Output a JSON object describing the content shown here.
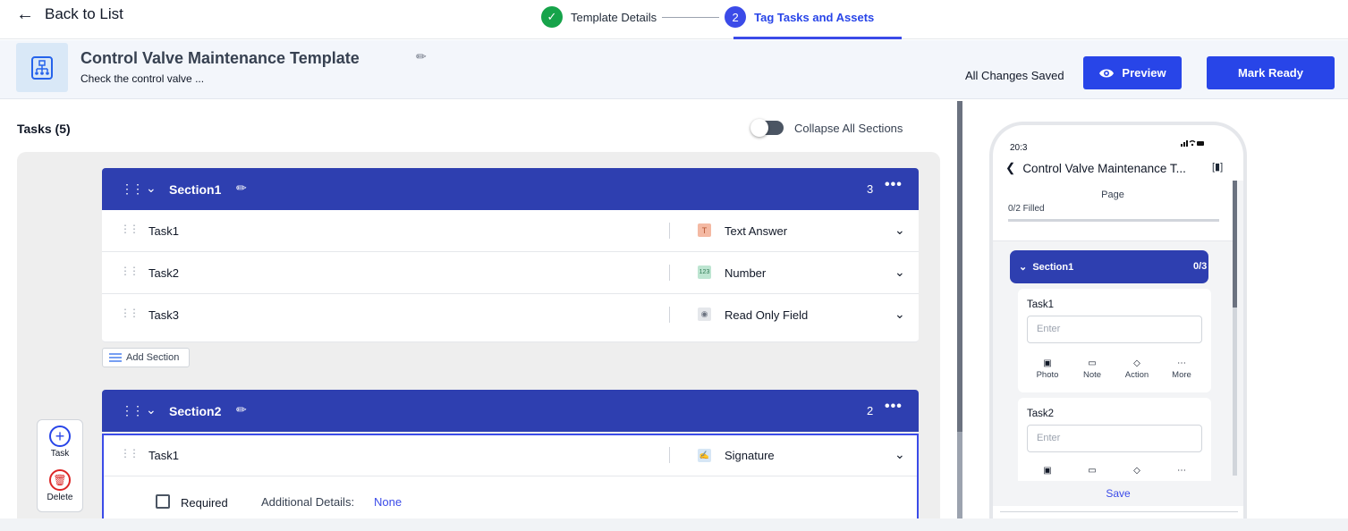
{
  "topbar": {
    "back_label": "Back to List",
    "steps": [
      {
        "number": "✓",
        "label": "Template Details",
        "state": "done"
      },
      {
        "number": "2",
        "label": "Tag Tasks and Assets",
        "state": "active"
      }
    ]
  },
  "header": {
    "title": "Control Valve Maintenance Template",
    "description": "Check the control valve ...",
    "save_status": "All Changes Saved",
    "preview_label": "Preview",
    "mark_ready_label": "Mark Ready"
  },
  "tasks_panel": {
    "heading": "Tasks (5)",
    "collapse_label": "Collapse All Sections",
    "collapse_on": false,
    "add_section_label": "Add Section",
    "sections": [
      {
        "name": "Section1",
        "count": "3",
        "tasks": [
          {
            "name": "Task1",
            "type": "Text Answer",
            "type_icon": "T",
            "icon_color": "#f4b9a3",
            "icon_text_color": "#b4532f"
          },
          {
            "name": "Task2",
            "type": "Number",
            "type_icon": "123",
            "icon_color": "#bde5d1",
            "icon_text_color": "#2f7a55"
          },
          {
            "name": "Task3",
            "type": "Read Only Field",
            "type_icon": "◉",
            "icon_color": "#e5e7eb",
            "icon_text_color": "#6b7280"
          }
        ]
      },
      {
        "name": "Section2",
        "count": "2",
        "tasks": [
          {
            "name": "Task1",
            "type": "Signature",
            "type_icon": "✍",
            "icon_color": "#d6e6f5",
            "icon_text_color": "#2563eb",
            "required_label": "Required",
            "required": false,
            "additional_details_label": "Additional Details:",
            "additional_details_value": "None"
          }
        ]
      }
    ],
    "floatbar": {
      "task_label": "Task",
      "delete_label": "Delete"
    }
  },
  "preview": {
    "time": "20:3",
    "status_icons": "…∩▬",
    "title": "Control Valve Maintenance T...",
    "page_label": "Page",
    "filled": "0/2 Filled",
    "section": {
      "name": "Section1",
      "count": "0/3"
    },
    "cards": [
      {
        "task": "Task1",
        "placeholder": "Enter"
      },
      {
        "task": "Task2",
        "placeholder": "Enter"
      }
    ],
    "actions": [
      {
        "icon": "image-icon",
        "label": "Photo"
      },
      {
        "icon": "note-icon",
        "label": "Note"
      },
      {
        "icon": "tag-icon",
        "label": "Action"
      },
      {
        "icon": "more-icon",
        "label": "More"
      }
    ],
    "save_label": "Save"
  },
  "colors": {
    "accent": "#2845e8",
    "section_header": "#2e3fb0",
    "success": "#16a34a",
    "delete": "#dc2626"
  }
}
